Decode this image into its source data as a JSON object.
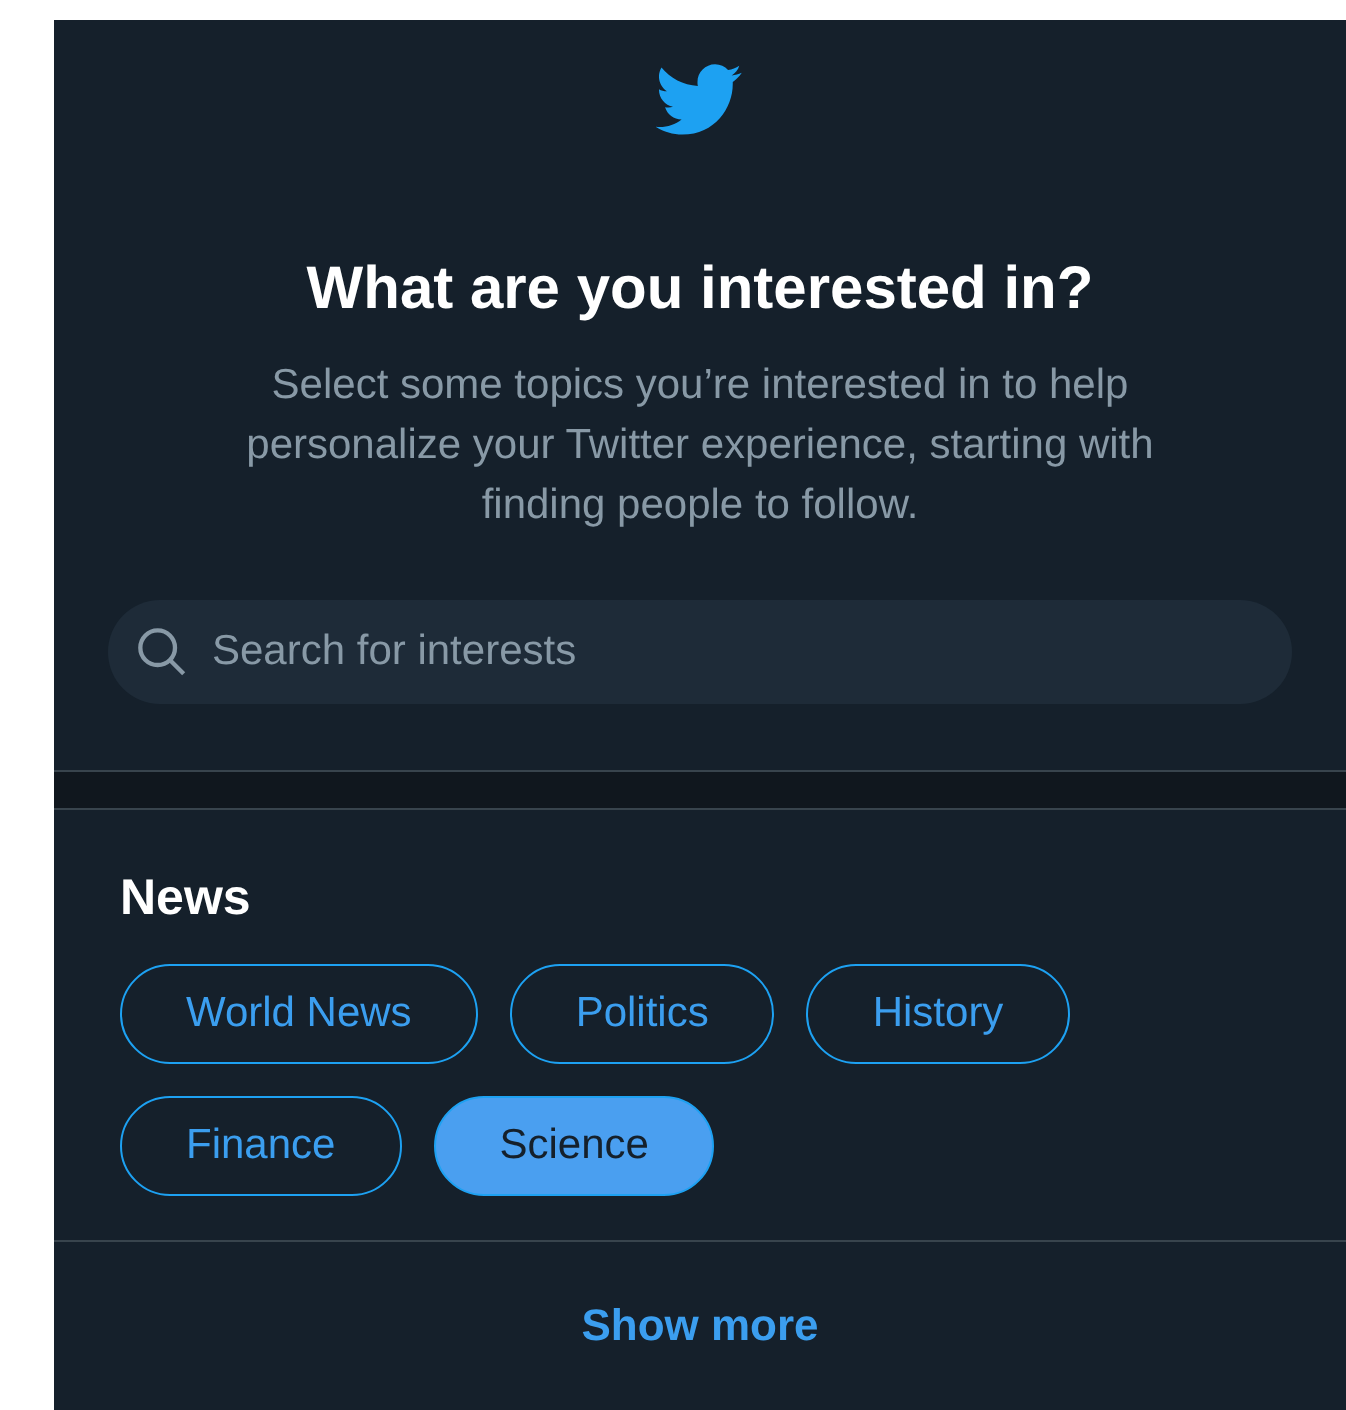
{
  "header": {
    "title": "What are you interested in?",
    "subtitle": "Select some topics you’re interested in to help personalize your Twitter experience, starting with finding people to follow."
  },
  "search": {
    "placeholder": "Search for interests"
  },
  "sections": [
    {
      "title": "News",
      "topics": [
        {
          "label": "World News",
          "selected": false
        },
        {
          "label": "Politics",
          "selected": false
        },
        {
          "label": "History",
          "selected": false
        },
        {
          "label": "Finance",
          "selected": false
        },
        {
          "label": "Science",
          "selected": true
        }
      ]
    }
  ],
  "footer": {
    "link": "Show more"
  }
}
